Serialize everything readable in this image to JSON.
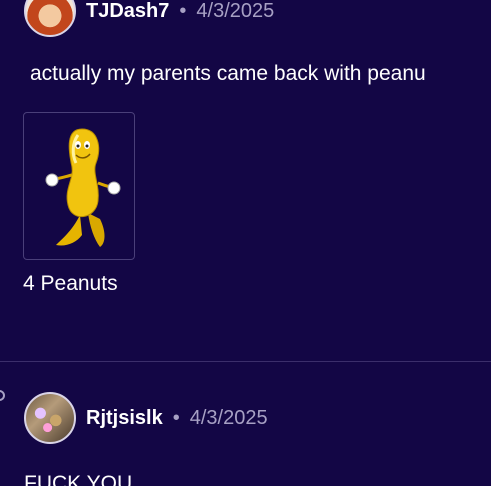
{
  "posts": [
    {
      "username": "TJDash7",
      "separator": "•",
      "date": "4/3/2025",
      "message": "actually my parents came back with peanu",
      "item": {
        "caption": "4 Peanuts",
        "icon": "peanut-mascot-icon"
      }
    },
    {
      "username": "Rjtjsislk",
      "separator": "•",
      "date": "4/3/2025",
      "message": "FUCK YOU"
    }
  ],
  "colors": {
    "background": "#130645",
    "muted_text": "#a7a0c4",
    "divider": "#3b2e6b"
  }
}
